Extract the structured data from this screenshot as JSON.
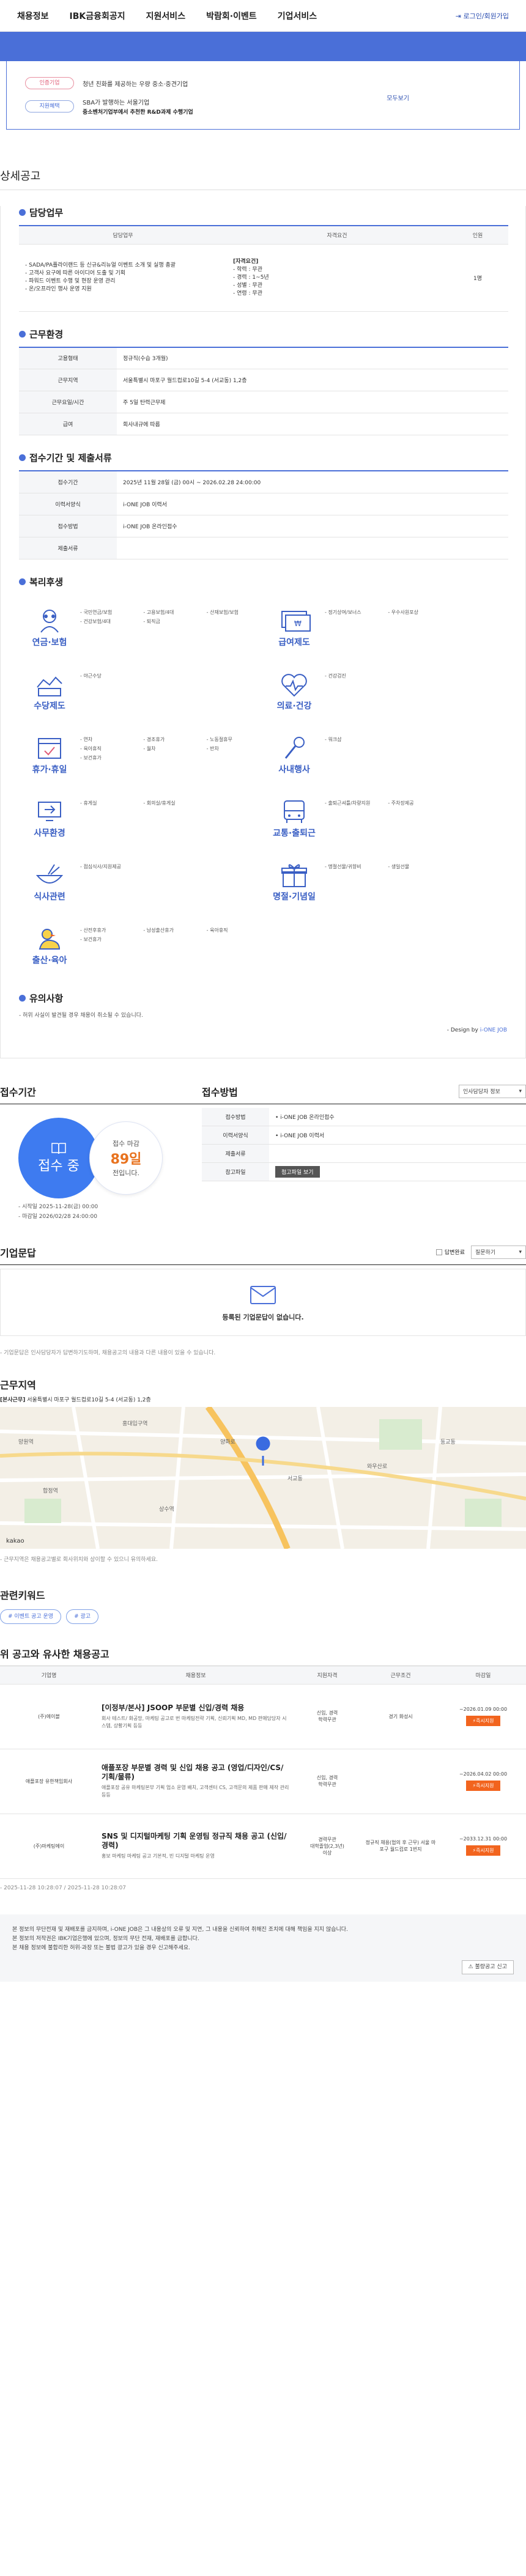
{
  "nav": {
    "items": [
      "채용정보",
      "IBK금융회공지",
      "지원서비스",
      "박람회·이벤트",
      "기업서비스"
    ],
    "login": "로그인/회원가입"
  },
  "top_card": {
    "more_link": "모두보기",
    "badges": [
      {
        "pill": "인증기업",
        "text": "청년 친화를 제공하는 우량 중소·중견기업"
      },
      {
        "pill": "지원혜택",
        "text": "SBA가 발행하는 서울기업"
      }
    ],
    "badge_sub": "중소벤처기업부에서 추천한 R&D과제 수행기업"
  },
  "detail": {
    "heading": "상세공고",
    "duty": {
      "title": "담당업무",
      "headers": [
        "담당업무",
        "자격요건",
        "인원"
      ],
      "duty_text": "- SADA/PA플라이랜드 등 신규&리뉴얼 이벤트 소개 및 실행 총괄\n- 고객사 요구에 따른 아이디어 도출 및 기획\n- 파워드 이벤트 수행 및 현장 운영 관리\n- 온/오프라인 행사 운영 지원",
      "req_title": "[자격요건]",
      "req_text": "- 학력 : 무관\n- 경력 : 1~5년\n- 성별 : 무관\n- 연령 : 무관",
      "count": "1명"
    },
    "environment": {
      "title": "근무환경",
      "rows": [
        {
          "label": "고용형태",
          "value": "정규직(수습 3개월)"
        },
        {
          "label": "근무지역",
          "value": "서울특별시 마포구 월드컵로10길 5-4 (서교동) 1,2층"
        },
        {
          "label": "근무요일/시간",
          "value": "주 5일 탄력근무제"
        },
        {
          "label": "급여",
          "value": "회사내규에 따름"
        }
      ]
    },
    "application": {
      "title": "접수기간 및 제출서류",
      "rows": [
        {
          "label": "접수기간",
          "value": "2025년 11월 28일 (금) 00시 ~ 2026.02.28 24:00:00"
        },
        {
          "label": "이력서양식",
          "value": "i-ONE JOB 이력서"
        },
        {
          "label": "접수방법",
          "value": "i-ONE JOB 온라인접수"
        },
        {
          "label": "제출서류",
          "value": ""
        }
      ]
    },
    "welfare": {
      "title": "복리후생",
      "cells": [
        {
          "icon": "insurance-icon",
          "name": "연금·보험",
          "items": [
            "국민연금/보험",
            "고용보험/4대",
            "산재보험/보험",
            "건강보험/4대",
            "퇴직금"
          ]
        },
        {
          "icon": "salary-icon",
          "name": "급여제도",
          "items": [
            "정기상여/보너스",
            "우수사원포상"
          ]
        },
        {
          "icon": "allowance-icon",
          "name": "수당제도",
          "items": [
            "야근수당"
          ]
        },
        {
          "icon": "health-icon",
          "name": "의료·건강",
          "items": [
            "건강검진"
          ]
        },
        {
          "icon": "vacation-icon",
          "name": "휴가·휴일",
          "items": [
            "연차",
            "경조휴가",
            "노동절휴무",
            "육아휴직",
            "월차",
            "반차",
            "보건휴가"
          ]
        },
        {
          "icon": "event-icon",
          "name": "사내행사",
          "items": [
            "워크샵"
          ]
        },
        {
          "icon": "office-icon",
          "name": "사무환경",
          "items": [
            "휴게실",
            "회의실/휴게실"
          ]
        },
        {
          "icon": "transport-icon",
          "name": "교통·출퇴근",
          "items": [
            "출퇴근셔틀/차량지원",
            "주차장제공"
          ]
        },
        {
          "icon": "meal-icon",
          "name": "식사관련",
          "items": [
            "점심식사/지원제공"
          ]
        },
        {
          "icon": "gift-icon",
          "name": "명절·기념일",
          "items": [
            "명절선물/귀향비",
            "생일선물"
          ]
        },
        {
          "icon": "childcare-icon",
          "name": "출산·육아",
          "items": [
            "산전후휴가",
            "남성출산휴가",
            "육아휴직",
            "보건휴가"
          ]
        }
      ]
    },
    "caution": {
      "title": "유의사항",
      "text": "- 허위 사실이 발견될 경우 채용이 취소될 수 있습니다."
    },
    "design_by_prefix": "- Design by ",
    "design_by_brand": "i-ONE JOB"
  },
  "reception": {
    "title": "접수기간",
    "status": "접수 중",
    "deadline_label": "접수 마감",
    "dday": "89일",
    "remaining": "전입니다.",
    "start": "- 시작일 2025-11-28(금) 00:00",
    "end": "- 마감일 2026/02/28 24:00:00"
  },
  "method": {
    "title": "접수방법",
    "select": "인사담당자 정보",
    "rows": [
      {
        "label": "접수방법",
        "value": "i-ONE JOB 온라인접수"
      },
      {
        "label": "이력서양식",
        "value": "i-ONE JOB 이력서"
      },
      {
        "label": "제출서류",
        "value": ""
      },
      {
        "label": "참고파일",
        "value": ""
      }
    ],
    "view_button": "첨고파일 보기"
  },
  "qa": {
    "title": "기업문답",
    "checkbox": "답변완료",
    "select": "질문하기",
    "empty": "등록된 기업문답이 없습니다.",
    "note": "- 기업문답은 인사담당자가 답변하기도하며, 채용공고의 내용과 다른 내용이 있을 수 있습니다."
  },
  "location": {
    "title": "근무지역",
    "address_label": "[본사근무]",
    "address": "서울특별시 마포구 월드컵로10길 5-4 (서교동) 1,2층",
    "note": "- 근무지역은 채용공고별로 회사위치와 상이할 수 있으니 유의하세요."
  },
  "keywords": {
    "title": "관련키워드",
    "items": [
      "이벤트 공고 운영",
      "광고"
    ]
  },
  "similar": {
    "title": "위 공고와 유사한 채용공고",
    "headers": [
      "기업명",
      "채용정보",
      "지원자격",
      "근무조건",
      "마감일"
    ],
    "rows": [
      {
        "company": "(주)에이블",
        "title": "[이정부/본사] JSOOP 부문별 신입/경력 채용",
        "desc": "회사 테스트/ 화공망, 마케팅 공고로 번 마케팅전략 기획, 신뢰기획 MD, MD 판매담당자 시스템, 상황기획 등등",
        "qual": "신입, 경력\n학력무관",
        "cond": "경기 화성시",
        "deadline": "~2026.01.09 00:00",
        "apply": "즉시지원"
      },
      {
        "company": "애플포장 유한책임회사",
        "title": "애플포장 부문별 경력 및 신입 채용 공고 (영업/디자인/CS/기획/물류)",
        "desc": "애플포장 공유 마케팅본부 기획 업소 운영 배치, 고객센터 CS, 고객문의 제품 판매 제작 관리 등등",
        "qual": "신입, 경력\n학력무관",
        "cond": "",
        "deadline": "~2026.04.02 00:00",
        "apply": "즉시지원"
      },
      {
        "company": "(주)마케팅에이",
        "title": "SNS 및 디지털마케팅 기획 운영팀 정규직 채용 공고 (신입/경력)",
        "desc": "홍보 마케팅 마케팅 공고 기본적, 빈 디지털 마케팅 운영",
        "qual": "경력무관\n대학졸업(2,3년)\n이상",
        "cond": "정규직 채용(협의 후 근무) 서울 마포구 월드컵로 1번지",
        "deadline": "~2033.12.31 00:00",
        "apply": "즉시지원"
      }
    ],
    "footnote": "- 2025-11-28 10:28:07 / 2025-11-28 10:28:07"
  },
  "footer": {
    "lines": [
      "본 정보의 무단전재 및 재배포를 금지하며, i-ONE JOB은 그 내용상의 오류 및 지연, 그 내용을 신뢰하여 취해진 조치에 대해 책임을 지지 않습니다.",
      "본 정보의 저작권은 IBK기업은행에 있으며, 정보의 무단 전재, 재배포를 금합니다.",
      "본 채용 정보에 불합리한 허위·과장 또는 불법 광고가 있을 경우 신고해주세요."
    ],
    "scroll_top": "불량공고 신고"
  },
  "map": {
    "labels": [
      "홍대입구역",
      "합정역",
      "상수역",
      "서교동",
      "망원역",
      "와우산로",
      "양화로",
      "동교동"
    ],
    "logo": "kakao"
  },
  "colors": {
    "accent": "#4a6fd8",
    "apply": "#f2641e",
    "dday": "#e8721e",
    "circle": "#3e7bf0"
  }
}
